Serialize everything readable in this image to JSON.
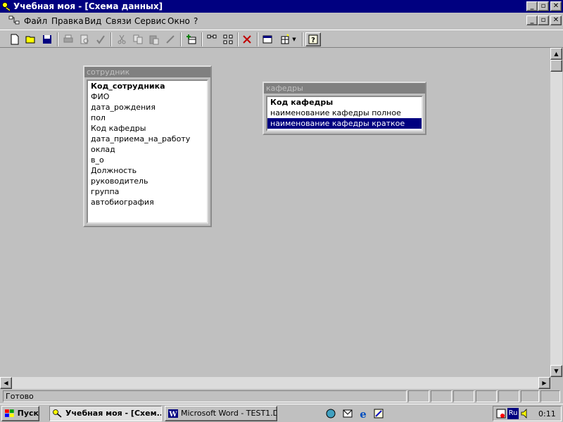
{
  "window": {
    "title": "Учебная моя - [Схема данных]"
  },
  "menu": [
    "Файл",
    "Правка",
    "Вид",
    "Связи",
    "Сервис",
    "Окно",
    "?"
  ],
  "tables": [
    {
      "caption": "сотрудник",
      "fields": [
        "Код_сотрудника",
        "ФИО",
        "дата_рождения",
        "пол",
        "Код кафедры",
        "дата_приема_на_работу",
        "оклад",
        "в_о",
        "Должность",
        "руководитель",
        "группа",
        "автобиография"
      ],
      "key_field": "Код_сотрудника"
    },
    {
      "caption": "кафедры",
      "fields": [
        "Код кафедры",
        "наименование кафедры полное",
        "наименование кафедры краткое"
      ],
      "key_field": "Код кафедры",
      "selected_field": "наименование кафедры краткое"
    }
  ],
  "status": {
    "text": "Готово"
  },
  "taskbar": {
    "start_label": "Пуск",
    "tasks": [
      "Учебная моя - [Схем...",
      "Microsoft Word - TEST1.D..."
    ],
    "lang": "Ru",
    "clock": "0:11"
  },
  "colors": {
    "title_bg": "#000080",
    "face": "#c0c0c0",
    "selection": "#000080"
  }
}
